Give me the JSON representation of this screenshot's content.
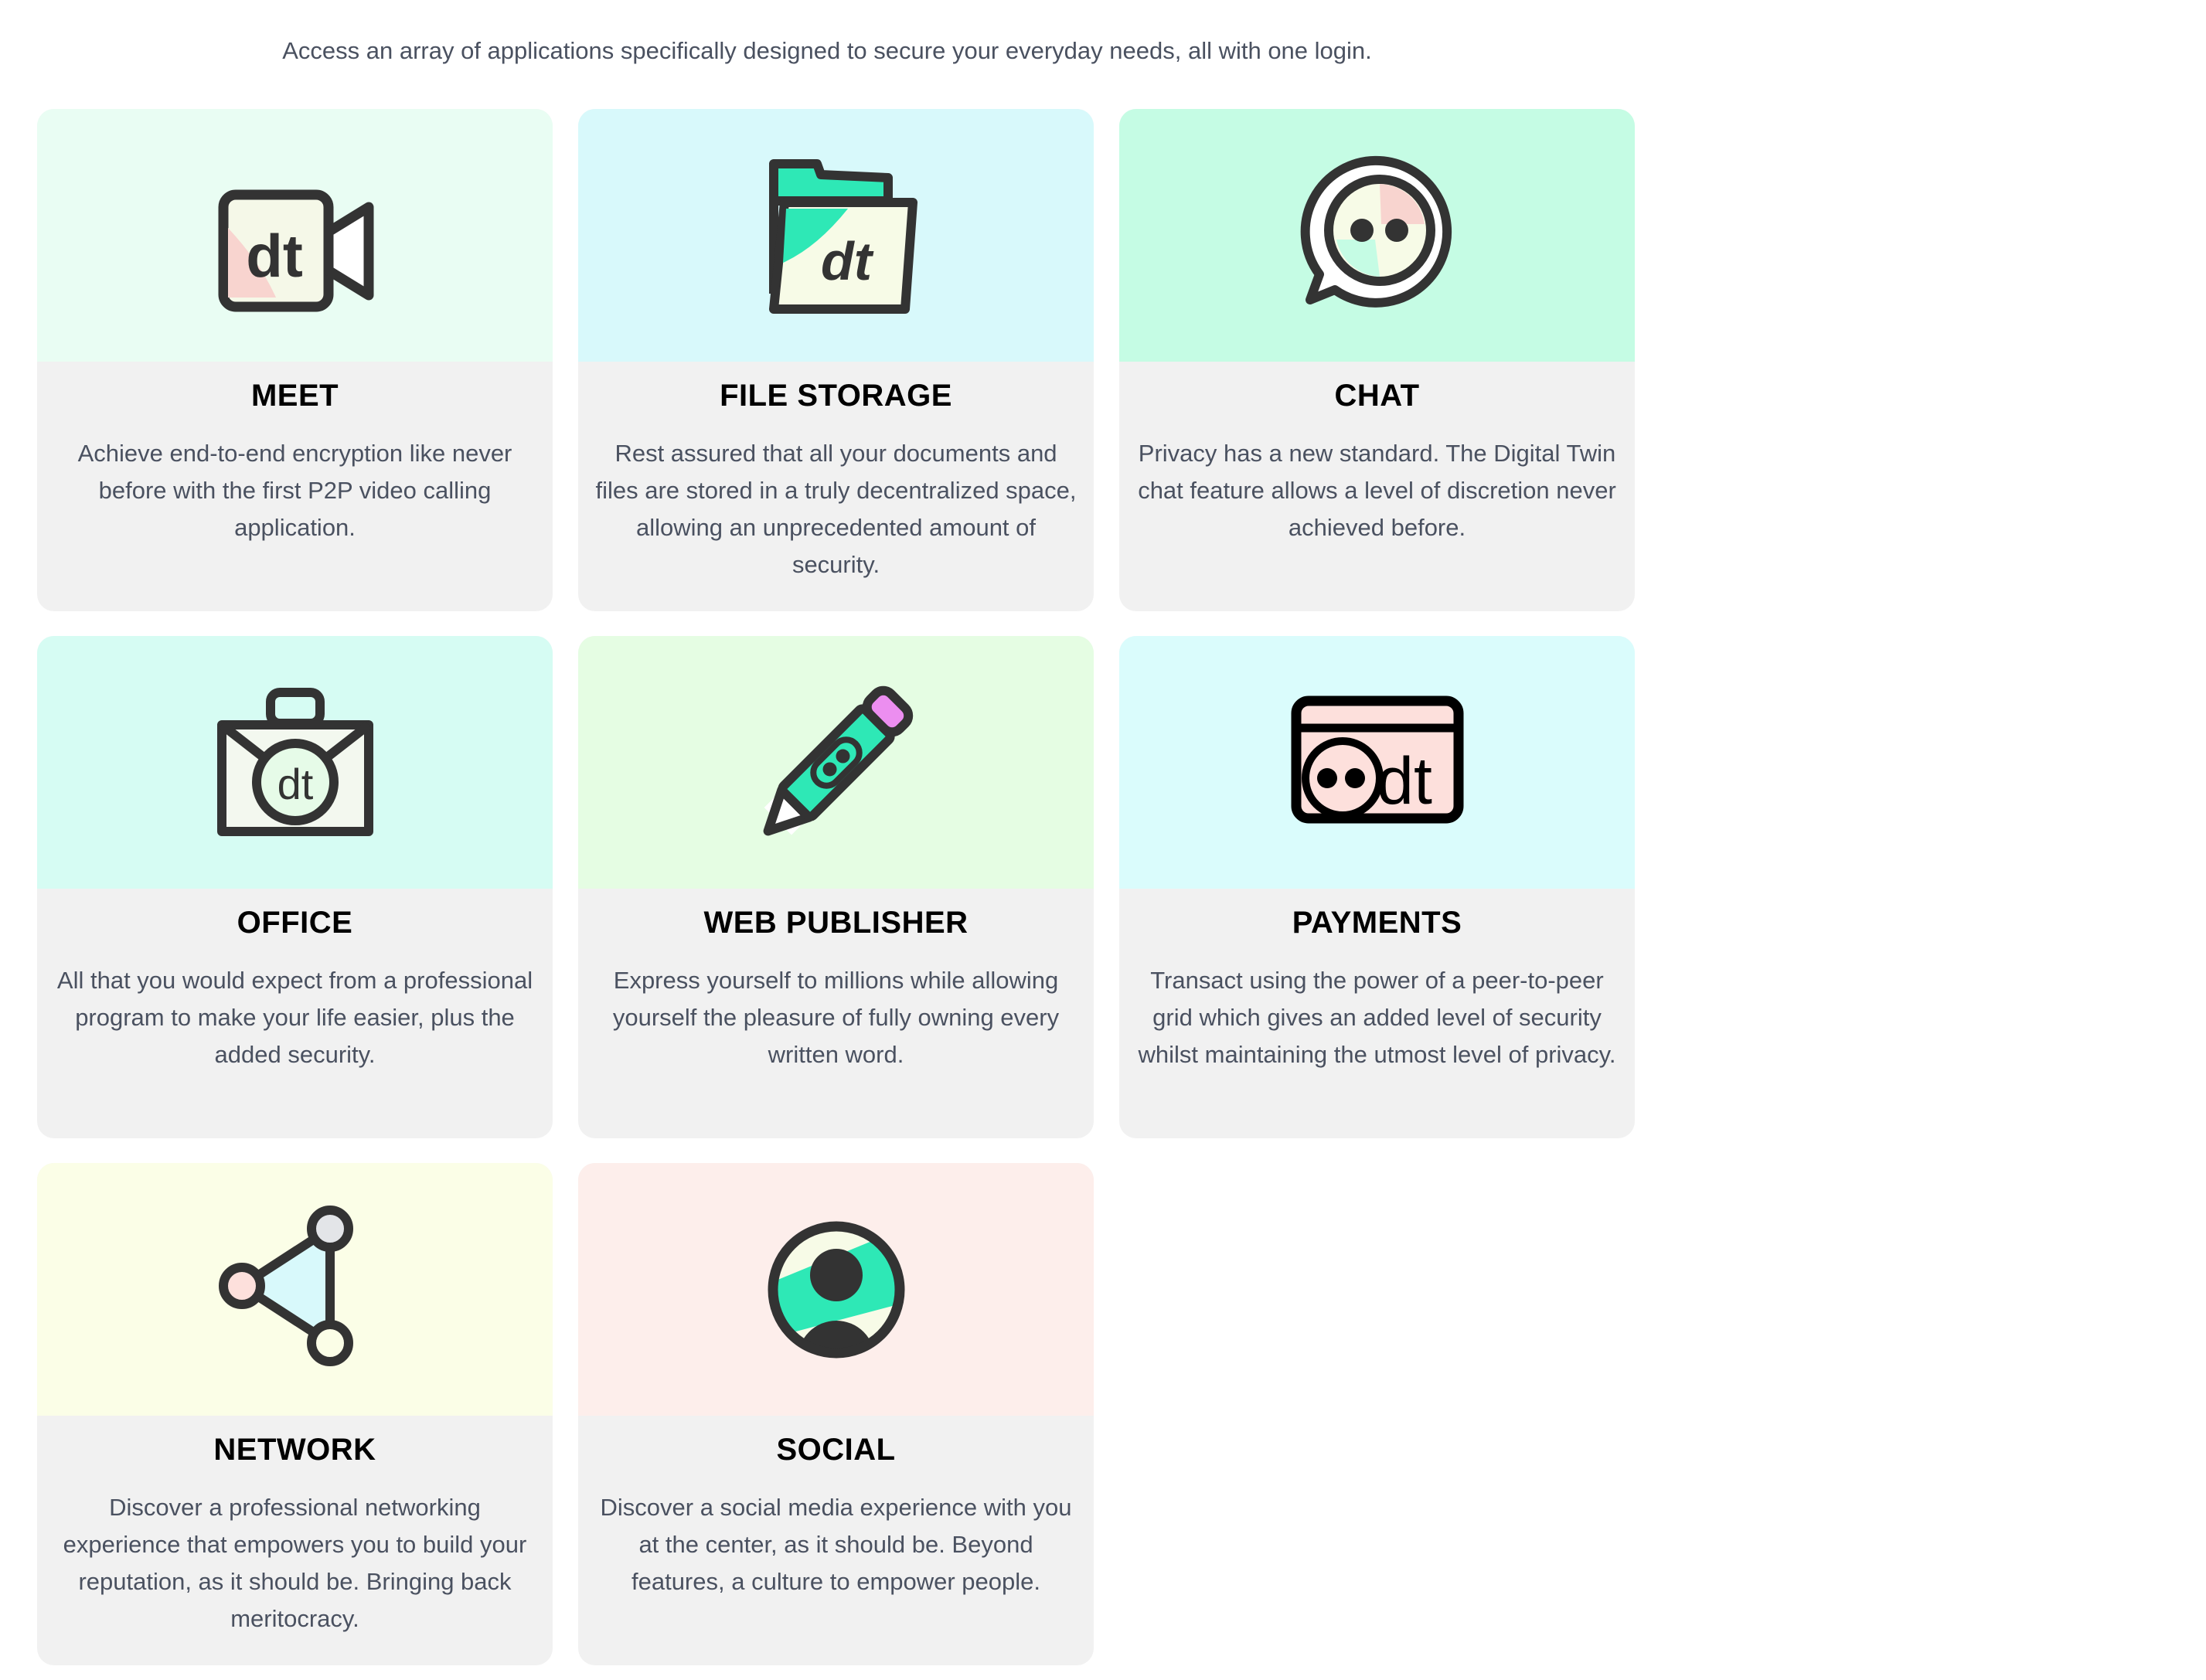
{
  "intro": "Access an array of applications specifically designed to secure your everyday needs, all with one login.",
  "cards": [
    {
      "icon": "video-camera-icon",
      "color": "#e9fdf3",
      "title": "MEET",
      "description": "Achieve end-to-end encryption like never before with the first P2P video calling application."
    },
    {
      "icon": "folder-icon",
      "color": "#d8f9fb",
      "title": "FILE STORAGE",
      "description": "Rest assured that all your documents and files are stored in a truly decentralized space, allowing an unprecedented amount of security."
    },
    {
      "icon": "chat-bubble-icon",
      "color": "#c5fce4",
      "title": "CHAT",
      "description": "Privacy has a new standard. The Digital Twin chat feature allows a level of discretion never achieved before."
    },
    {
      "icon": "briefcase-icon",
      "color": "#d6fcf3",
      "title": "OFFICE",
      "description": "All that you would expect from a professional program to make your life easier, plus the added security."
    },
    {
      "icon": "pencil-icon",
      "color": "#e5fde3",
      "title": "WEB PUBLISHER",
      "description": "Express yourself to millions while allowing yourself the pleasure of fully owning every written word."
    },
    {
      "icon": "payment-card-icon",
      "color": "#dafcfc",
      "title": "PAYMENTS",
      "description": "Transact using the power of a peer-to-peer grid which gives an added level of security whilst maintaining the utmost level of privacy."
    },
    {
      "icon": "network-icon",
      "color": "#fbfee7",
      "title": "NETWORK",
      "description": "Discover a professional networking experience that empowers you to build your reputation, as it should be. Bringing back meritocracy."
    },
    {
      "icon": "user-avatar-icon",
      "color": "#fdeeeb",
      "title": "SOCIAL",
      "description": "Discover a social media experience with you at the center, as it should be. Beyond features, a culture to empower people."
    }
  ]
}
